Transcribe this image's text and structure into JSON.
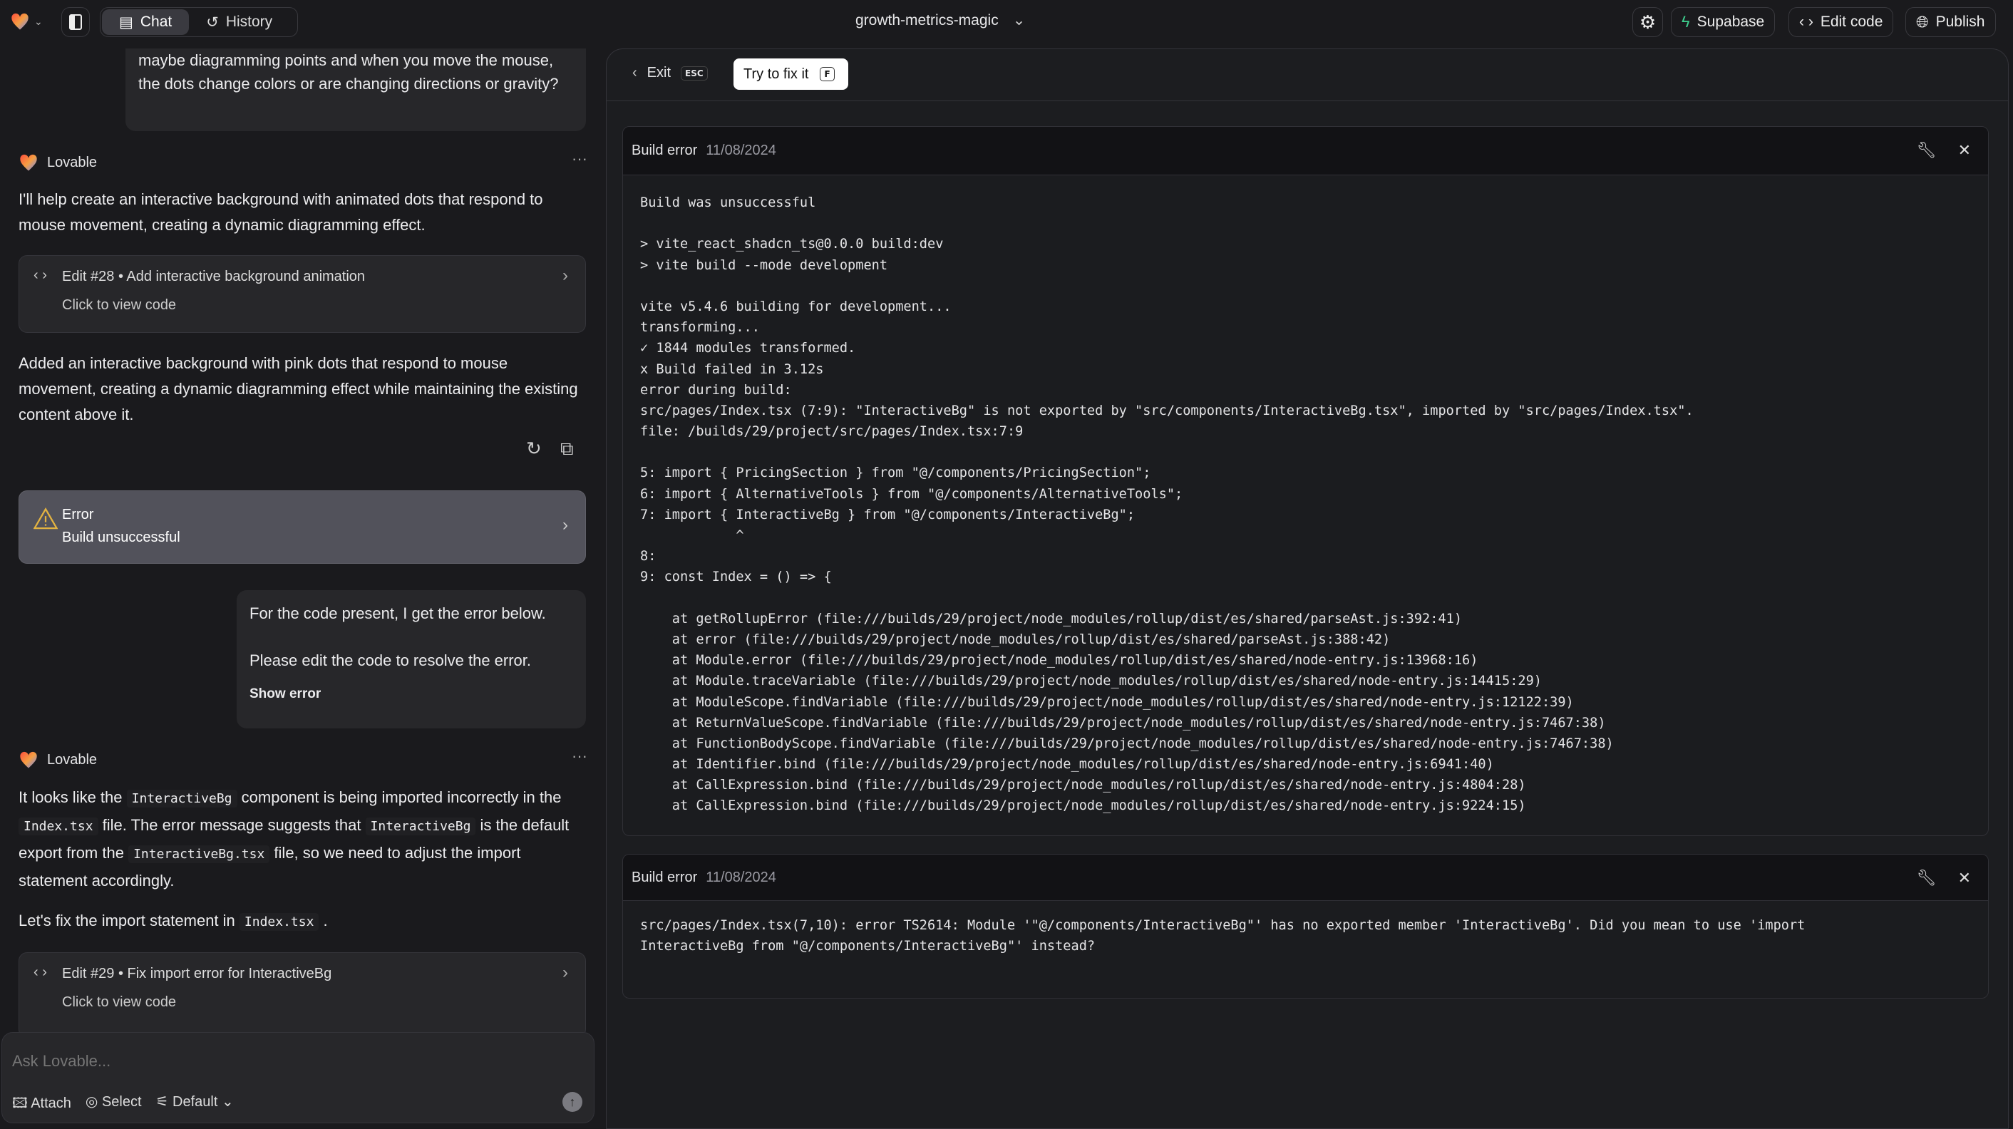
{
  "topbar": {
    "tabs": [
      {
        "label": "Chat",
        "icon": "chat-icon",
        "active": true
      },
      {
        "label": "History",
        "icon": "history-icon"
      }
    ],
    "project_title": "growth-metrics-magic",
    "buttons": {
      "supabase": "Supabase",
      "edit_code": "Edit code",
      "publish": "Publish"
    },
    "supabase_color": "#3ecf8e"
  },
  "chat": {
    "user_msg_1": "maybe diagramming points and when you move the mouse, the dots change colors or are changing directions or gravity?",
    "assistant_name": "Lovable",
    "assistant_msg_1": "I'll help create an interactive background with animated dots that respond to mouse movement, creating a dynamic diagramming effect.",
    "edit_28": {
      "title": "Edit #28 • Add interactive background animation",
      "subtitle": "Click to view code"
    },
    "assistant_msg_2": "Added an interactive background with pink dots that respond to mouse movement, creating a dynamic diagramming effect while maintaining the existing content above it.",
    "error_card": {
      "title": "Error",
      "subtitle": "Build unsuccessful",
      "icon_color": "#e3b341"
    },
    "user_msg_2": {
      "line1": "For the code present, I get the error below.",
      "line2": "Please edit the code to resolve the error.",
      "show_error": "Show error"
    },
    "assistant_msg_3": {
      "s1": "It looks like the ",
      "c1": "InteractiveBg",
      "s2": " component is being imported incorrectly in the ",
      "c2": "Index.tsx",
      "s3": " file. The error message suggests that ",
      "c3": "InteractiveBg",
      "s4": " is the default export from the ",
      "c4": "InteractiveBg.tsx",
      "s5": " file, so we need to adjust the import statement accordingly."
    },
    "assistant_msg_4": {
      "s1": "Let's fix the import statement in ",
      "c1": "Index.tsx",
      "s2": " ."
    },
    "edit_29": {
      "title": "Edit #29 • Fix import error for InteractiveBg",
      "subtitle": "Click to view code"
    },
    "input": {
      "placeholder": "Ask Lovable...",
      "attach": "Attach",
      "select": "Select",
      "mode": "Default"
    }
  },
  "error_panel": {
    "exit_label": "Exit",
    "exit_key": "ESC",
    "fix_label": "Try to fix it",
    "fix_key": "F",
    "errors": [
      {
        "title": "Build error",
        "date": "11/08/2024",
        "lines": [
          "Build was unsuccessful",
          "",
          "> vite_react_shadcn_ts@0.0.0 build:dev",
          "> vite build --mode development",
          "",
          "vite v5.4.6 building for development...",
          "transforming...",
          "✓ 1844 modules transformed.",
          "x Build failed in 3.12s",
          "error during build:",
          "src/pages/Index.tsx (7:9): \"InteractiveBg\" is not exported by \"src/components/InteractiveBg.tsx\", imported by \"src/pages/Index.tsx\".",
          "file: /builds/29/project/src/pages/Index.tsx:7:9",
          "",
          "5: import { PricingSection } from \"@/components/PricingSection\";",
          "6: import { AlternativeTools } from \"@/components/AlternativeTools\";",
          "7: import { InteractiveBg } from \"@/components/InteractiveBg\";",
          "            ^",
          "8:",
          "9: const Index = () => {",
          "",
          "    at getRollupError (file:///builds/29/project/node_modules/rollup/dist/es/shared/parseAst.js:392:41)",
          "    at error (file:///builds/29/project/node_modules/rollup/dist/es/shared/parseAst.js:388:42)",
          "    at Module.error (file:///builds/29/project/node_modules/rollup/dist/es/shared/node-entry.js:13968:16)",
          "    at Module.traceVariable (file:///builds/29/project/node_modules/rollup/dist/es/shared/node-entry.js:14415:29)",
          "    at ModuleScope.findVariable (file:///builds/29/project/node_modules/rollup/dist/es/shared/node-entry.js:12122:39)",
          "    at ReturnValueScope.findVariable (file:///builds/29/project/node_modules/rollup/dist/es/shared/node-entry.js:7467:38)",
          "    at FunctionBodyScope.findVariable (file:///builds/29/project/node_modules/rollup/dist/es/shared/node-entry.js:7467:38)",
          "    at Identifier.bind (file:///builds/29/project/node_modules/rollup/dist/es/shared/node-entry.js:6941:40)",
          "    at CallExpression.bind (file:///builds/29/project/node_modules/rollup/dist/es/shared/node-entry.js:4804:28)",
          "    at CallExpression.bind (file:///builds/29/project/node_modules/rollup/dist/es/shared/node-entry.js:9224:15)"
        ]
      },
      {
        "title": "Build error",
        "date": "11/08/2024",
        "lines": [
          "src/pages/Index.tsx(7,10): error TS2614: Module '\"@/components/InteractiveBg\"' has no exported member 'InteractiveBg'. Did you mean to use 'import",
          "InteractiveBg from \"@/components/InteractiveBg\"' instead?"
        ]
      }
    ]
  }
}
